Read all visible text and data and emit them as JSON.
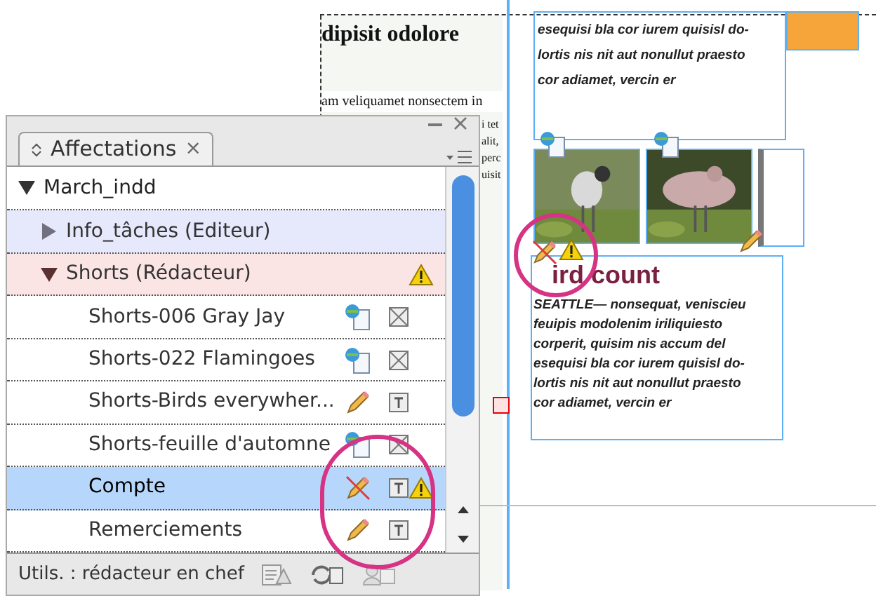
{
  "document": {
    "headline": "dipisit odolore",
    "intro": "am veliquamet nonsectem in",
    "column_fragments": [
      "i tet",
      "alit,",
      "perc",
      "uisit"
    ],
    "top_story_lines": [
      "esequisi bla cor iurem quisisl do-",
      "lortis nis nit aut nonullut praesto",
      "cor adiamet, vercin er"
    ],
    "story_heading": "ird count",
    "story_lines": [
      "SEATTLE— nonsequat, veniscieu",
      "feuipis modolenim iriliquiesto",
      "corperit, quisim nis accum del",
      "esequisi bla cor iurem quisisl do-",
      "lortis nis nit aut nonullut praesto",
      "cor adiamet, vercin er"
    ],
    "photos": [
      {
        "kind": "picture"
      },
      {
        "kind": "picture"
      }
    ]
  },
  "panel": {
    "tab": "Affectations",
    "close": "×",
    "document_name": "March_indd",
    "document_expanded": true,
    "rows": [
      {
        "kind": "group",
        "label": "Info_tâches (Editeur)",
        "expanded": false,
        "color": "#e6e8fb",
        "warning": false
      },
      {
        "kind": "group",
        "label": "Shorts (Rédacteur)",
        "expanded": true,
        "color": "#fbe4e4",
        "warning": true
      },
      {
        "kind": "item",
        "label": "Shorts-006 Gray Jay",
        "linked": true,
        "text_frame": false,
        "warning": false,
        "selected": false
      },
      {
        "kind": "item",
        "label": "Shorts-022 Flamingoes",
        "linked": true,
        "text_frame": false,
        "warning": false,
        "selected": false
      },
      {
        "kind": "item",
        "label": "Shorts-Birds everywher...",
        "linked": false,
        "blocked": false,
        "text_frame": true,
        "warning": false,
        "selected": false
      },
      {
        "kind": "item",
        "label": "Shorts-feuille d'automne",
        "linked": true,
        "text_frame": false,
        "warning": false,
        "selected": false
      },
      {
        "kind": "item",
        "label": "Compte",
        "linked": false,
        "blocked": true,
        "text_frame": true,
        "warning": true,
        "selected": true
      },
      {
        "kind": "item",
        "label": "Remerciements",
        "linked": false,
        "blocked": false,
        "text_frame": true,
        "warning": false,
        "selected": false
      }
    ],
    "footer": "Utils. : rédacteur en chef"
  }
}
